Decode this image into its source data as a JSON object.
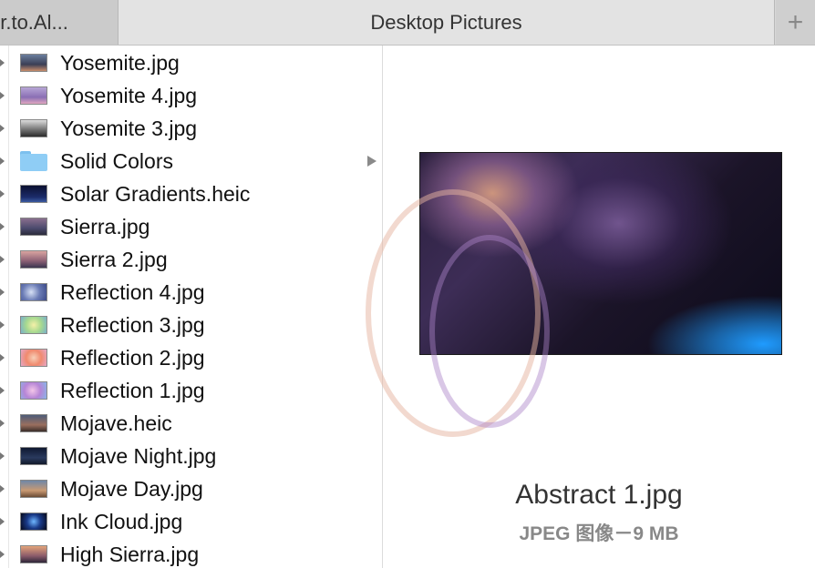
{
  "tabs": {
    "left_label": "er.to.Al...",
    "active_label": "Desktop Pictures",
    "add_icon": "plus-icon"
  },
  "files": [
    {
      "name": "Yosemite.jpg",
      "kind": "image",
      "thumb": "linear-gradient(180deg,#6a7e9e,#3b3f55 60%,#c88c6a)"
    },
    {
      "name": "Yosemite 4.jpg",
      "kind": "image",
      "thumb": "linear-gradient(180deg,#b7a6d6,#8a6fb4 60%,#e0a6c0)"
    },
    {
      "name": "Yosemite 3.jpg",
      "kind": "image",
      "thumb": "linear-gradient(180deg,#dcdcdc,#6f6f6f 60%,#2b2b2b)"
    },
    {
      "name": "Solid Colors",
      "kind": "folder",
      "thumb": ""
    },
    {
      "name": "Solar Gradients.heic",
      "kind": "image",
      "thumb": "linear-gradient(180deg,#0b1030,#1c2c6a 70%,#3a5aa0)"
    },
    {
      "name": "Sierra.jpg",
      "kind": "image",
      "thumb": "linear-gradient(180deg,#8a6f8e,#4b4a6d 60%,#2b2b3a)"
    },
    {
      "name": "Sierra 2.jpg",
      "kind": "image",
      "thumb": "linear-gradient(180deg,#d9a4a0,#8a5f74 60%,#3b3550)"
    },
    {
      "name": "Reflection 4.jpg",
      "kind": "image",
      "thumb": "radial-gradient(circle at 40% 50%,#d6e0f5,#6a7bb5 50%,#3c4a88)"
    },
    {
      "name": "Reflection 3.jpg",
      "kind": "image",
      "thumb": "radial-gradient(circle at 50% 50%,#f5f0a8,#a7d98f 50%,#78b0c9)"
    },
    {
      "name": "Reflection 2.jpg",
      "kind": "image",
      "thumb": "radial-gradient(circle at 50% 50%,#f7d0b8,#f08a6e 50%,#e6a7c7)"
    },
    {
      "name": "Reflection 1.jpg",
      "kind": "image",
      "thumb": "radial-gradient(circle at 45% 50%,#f3c6e8,#b685d6 50%,#89b5e8)"
    },
    {
      "name": "Mojave.heic",
      "kind": "image",
      "thumb": "linear-gradient(180deg,#4e5c78,#9a6f5e 60%,#3a2d29)"
    },
    {
      "name": "Mojave Night.jpg",
      "kind": "image",
      "thumb": "linear-gradient(180deg,#0f1830,#2a3a5e 60%,#121a2a)"
    },
    {
      "name": "Mojave Day.jpg",
      "kind": "image",
      "thumb": "linear-gradient(180deg,#6f87a8,#c99a73 60%,#6b4b35)"
    },
    {
      "name": "Ink Cloud.jpg",
      "kind": "image",
      "thumb": "radial-gradient(circle at 50% 50%,#6fb7ff,#1a3b8a 45%,#05081a)"
    },
    {
      "name": "High Sierra.jpg",
      "kind": "image",
      "thumb": "linear-gradient(180deg,#e3a37a,#8a5a6a 60%,#2d2538)"
    }
  ],
  "preview": {
    "filename": "Abstract 1.jpg",
    "info": "JPEG 图像－9 MB",
    "accent_colors": [
      "#2a1f3d",
      "#1f9bff",
      "#dca082"
    ]
  },
  "colors": {
    "tabbar_bg": "#d6d6d6",
    "active_tab_bg": "#e3e3e3",
    "folder_blue": "#8fcdf5"
  }
}
